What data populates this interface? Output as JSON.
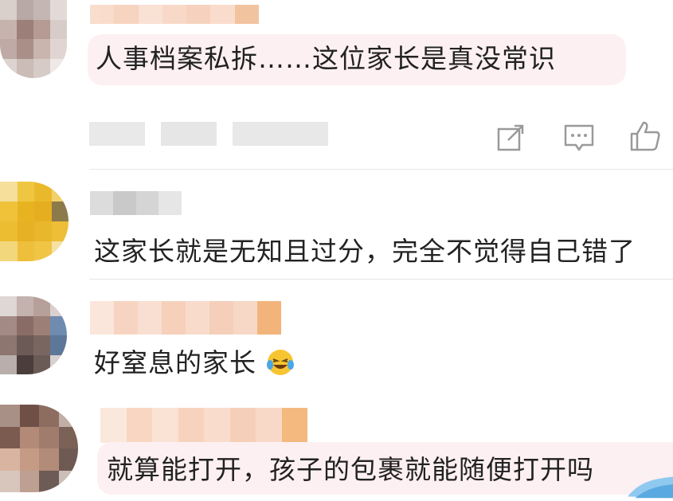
{
  "comments": [
    {
      "id": 1,
      "text": "人事档案私拆……这位家长是真没常识",
      "emoji": ""
    },
    {
      "id": 2,
      "text": "这家长就是无知且过分，完全不觉得自己错了",
      "emoji": ""
    },
    {
      "id": 3,
      "text": "好窒息的家长",
      "emoji": "laughing-crying-emoji"
    },
    {
      "id": 4,
      "text": "就算能打开，孩子的包裹就能随便打开吗",
      "emoji": ""
    }
  ],
  "actions": {
    "share_icon": "share-icon",
    "reply_icon": "comment-icon",
    "like_icon": "thumbs-up-icon"
  },
  "colors": {
    "highlight_bubble": "#fdf0f2",
    "divider": "#e6e6e6",
    "icon": "#9a9a9a",
    "name_blur": "#f7c9a8"
  }
}
